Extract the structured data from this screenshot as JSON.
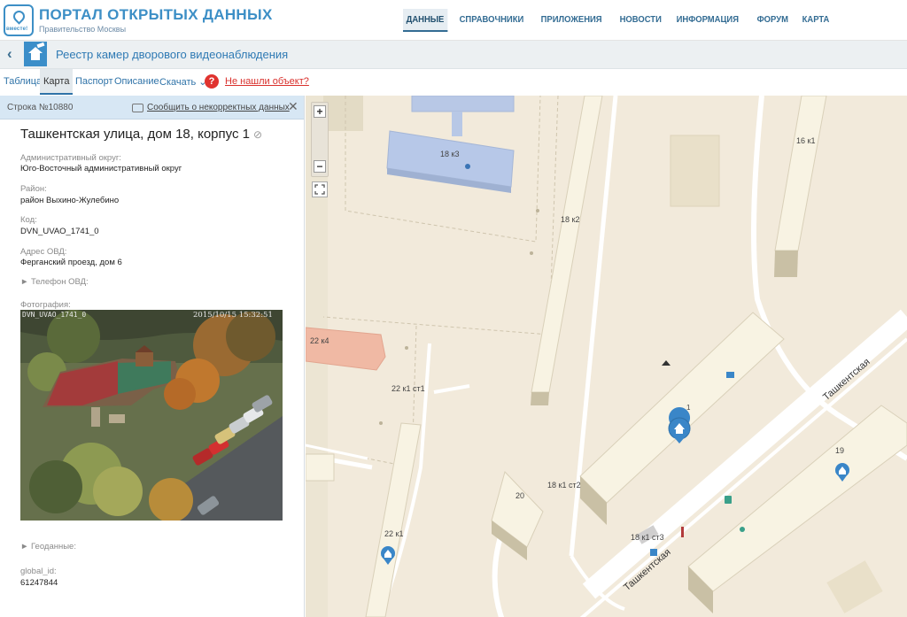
{
  "header": {
    "logo_word": "вместе!",
    "portal_title": "ПОРТАЛ ОТКРЫТЫХ ДАННЫХ",
    "portal_subtitle": "Правительство Москвы",
    "nav": [
      {
        "label": "ДАННЫЕ",
        "active": true
      },
      {
        "label": "СПРАВОЧНИКИ",
        "active": false
      },
      {
        "label": "ПРИЛОЖЕНИЯ",
        "active": false
      },
      {
        "label": "НОВОСТИ",
        "active": false
      },
      {
        "label": "ИНФОРМАЦИЯ",
        "active": false
      },
      {
        "label": "ФОРУМ",
        "active": false
      },
      {
        "label": "КАРТА",
        "active": false
      }
    ]
  },
  "dataset": {
    "title": "Реестр камер дворового видеонаблюдения",
    "icon": "house-camera-icon"
  },
  "tabs": [
    {
      "label": "Таблица",
      "active": false
    },
    {
      "label": "Карта",
      "active": true
    },
    {
      "label": "Паспорт",
      "active": false
    },
    {
      "label": "Описание",
      "active": false
    },
    {
      "label": "Скачать ⌄",
      "active": false
    }
  ],
  "help": {
    "icon_text": "?",
    "link": "Не нашли объект?"
  },
  "record": {
    "row_label": "Строка №10880",
    "report_link": "Сообщить о некорректных данных",
    "close": "✕",
    "title": "Ташкентская улица, дом 18, корпус 1",
    "fields": [
      {
        "label": "Административный округ:",
        "value": "Юго-Восточный административный округ"
      },
      {
        "label": "Район:",
        "value": "район Выхино-Жулебино"
      },
      {
        "label": "Код:",
        "value": "DVN_UVAO_1741_0"
      },
      {
        "label": "Адрес ОВД:",
        "value": "Ферганский проезд, дом 6"
      }
    ],
    "phone_expander": "► Телефон ОВД:",
    "photo_label": "Фотография:",
    "photo_overlay_left": "DVN_UVAO_1741_0",
    "photo_overlay_right": "2015/10/15 15:32:51",
    "geo_expander": "► Геоданные:",
    "global_id_label": "global_id:",
    "global_id_value": "61247844"
  },
  "map": {
    "labels": {
      "b18k3": "18 к3",
      "b18k2": "18 к2",
      "b16k1": "16 к1",
      "b22k4": "22 к4",
      "b22k1st1": "22 к1 ст1",
      "b18k1st2": "18 к1 ст2",
      "b20": "20",
      "b22k1": "22 к1",
      "b18k1st3": "18 к1 ст3",
      "b19": "19",
      "b1": "1",
      "street_upper": "Ташкентская",
      "street_lower": "Ташкентская"
    },
    "colors": {
      "background": "#f2eadb",
      "road": "#ffffff",
      "building": "#e6dcc3",
      "pin": "#3a86c8"
    }
  }
}
